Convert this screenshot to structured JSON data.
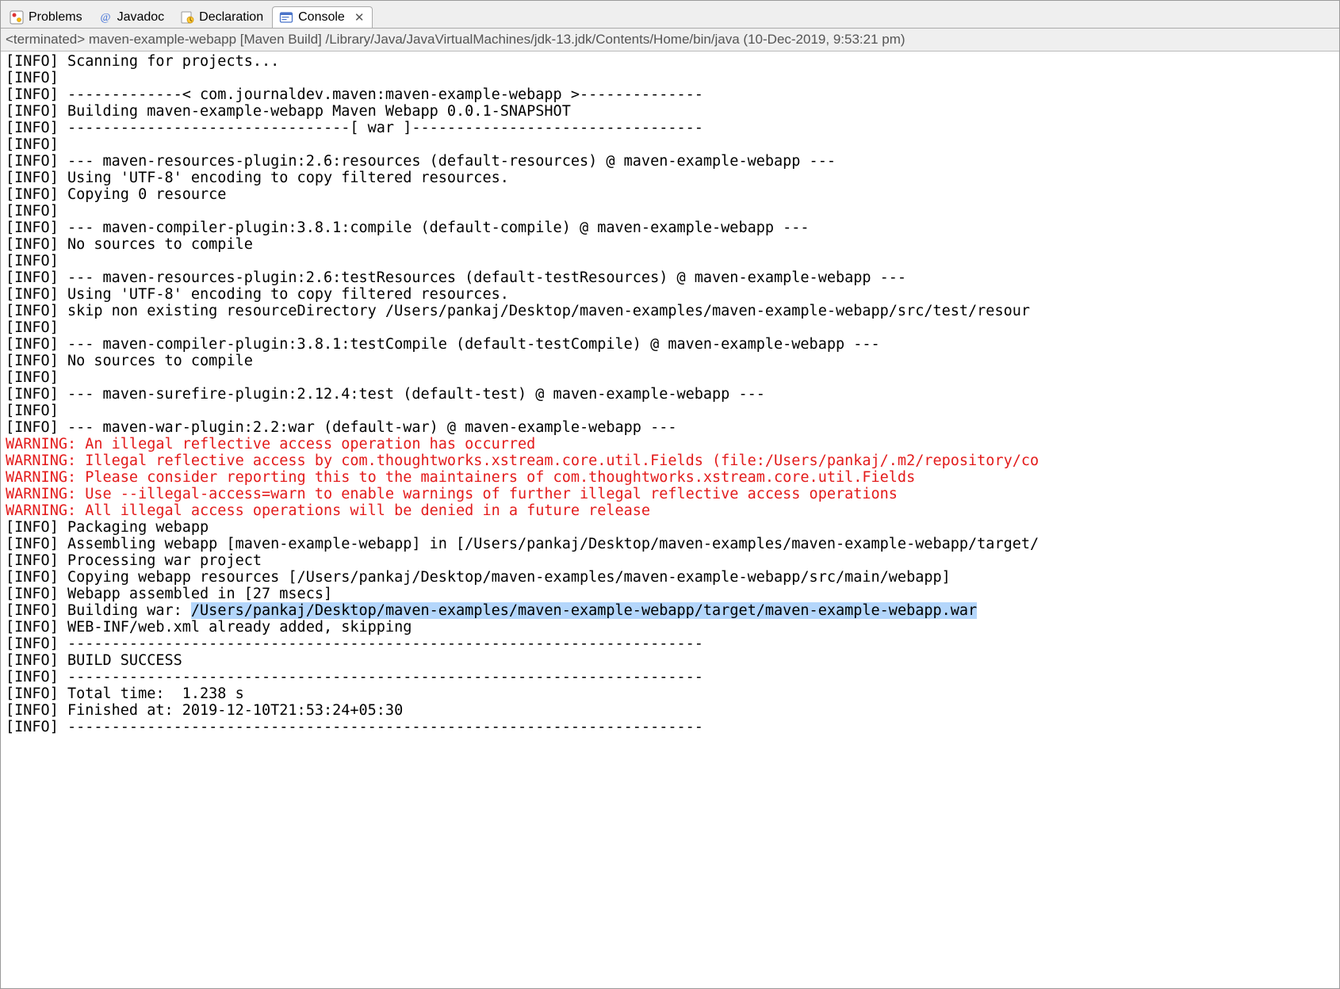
{
  "tabs": {
    "problems": "Problems",
    "javadoc": "Javadoc",
    "declaration": "Declaration",
    "console": "Console"
  },
  "processLine": "<terminated> maven-example-webapp [Maven Build] /Library/Java/JavaVirtualMachines/jdk-13.jdk/Contents/Home/bin/java (10-Dec-2019, 9:53:21 pm)",
  "log": {
    "l01": "[INFO] Scanning for projects...",
    "l02": "[INFO] ",
    "l03": "[INFO] -------------< com.journaldev.maven:maven-example-webapp >--------------",
    "l04": "[INFO] Building maven-example-webapp Maven Webapp 0.0.1-SNAPSHOT",
    "l05": "[INFO] --------------------------------[ war ]---------------------------------",
    "l06": "[INFO] ",
    "l07": "[INFO] --- maven-resources-plugin:2.6:resources (default-resources) @ maven-example-webapp ---",
    "l08": "[INFO] Using 'UTF-8' encoding to copy filtered resources.",
    "l09": "[INFO] Copying 0 resource",
    "l10": "[INFO] ",
    "l11": "[INFO] --- maven-compiler-plugin:3.8.1:compile (default-compile) @ maven-example-webapp ---",
    "l12": "[INFO] No sources to compile",
    "l13": "[INFO] ",
    "l14": "[INFO] --- maven-resources-plugin:2.6:testResources (default-testResources) @ maven-example-webapp ---",
    "l15": "[INFO] Using 'UTF-8' encoding to copy filtered resources.",
    "l16": "[INFO] skip non existing resourceDirectory /Users/pankaj/Desktop/maven-examples/maven-example-webapp/src/test/resour",
    "l17": "[INFO] ",
    "l18": "[INFO] --- maven-compiler-plugin:3.8.1:testCompile (default-testCompile) @ maven-example-webapp ---",
    "l19": "[INFO] No sources to compile",
    "l20": "[INFO] ",
    "l21": "[INFO] --- maven-surefire-plugin:2.12.4:test (default-test) @ maven-example-webapp ---",
    "l22": "[INFO] ",
    "l23": "[INFO] --- maven-war-plugin:2.2:war (default-war) @ maven-example-webapp ---",
    "w1": "WARNING: An illegal reflective access operation has occurred",
    "w2": "WARNING: Illegal reflective access by com.thoughtworks.xstream.core.util.Fields (file:/Users/pankaj/.m2/repository/co",
    "w3": "WARNING: Please consider reporting this to the maintainers of com.thoughtworks.xstream.core.util.Fields",
    "w4": "WARNING: Use --illegal-access=warn to enable warnings of further illegal reflective access operations",
    "w5": "WARNING: All illegal access operations will be denied in a future release",
    "l24": "[INFO] Packaging webapp",
    "l25": "[INFO] Assembling webapp [maven-example-webapp] in [/Users/pankaj/Desktop/maven-examples/maven-example-webapp/target/",
    "l26": "[INFO] Processing war project",
    "l27": "[INFO] Copying webapp resources [/Users/pankaj/Desktop/maven-examples/maven-example-webapp/src/main/webapp]",
    "l28": "[INFO] Webapp assembled in [27 msecs]",
    "l29a": "[INFO] Building war: ",
    "l29b": "/Users/pankaj/Desktop/maven-examples/maven-example-webapp/target/maven-example-webapp.war",
    "l30": "[INFO] WEB-INF/web.xml already added, skipping",
    "l31": "[INFO] ------------------------------------------------------------------------",
    "l32": "[INFO] BUILD SUCCESS",
    "l33": "[INFO] ------------------------------------------------------------------------",
    "l34": "[INFO] Total time:  1.238 s",
    "l35": "[INFO] Finished at: 2019-12-10T21:53:24+05:30",
    "l36": "[INFO] ------------------------------------------------------------------------"
  }
}
